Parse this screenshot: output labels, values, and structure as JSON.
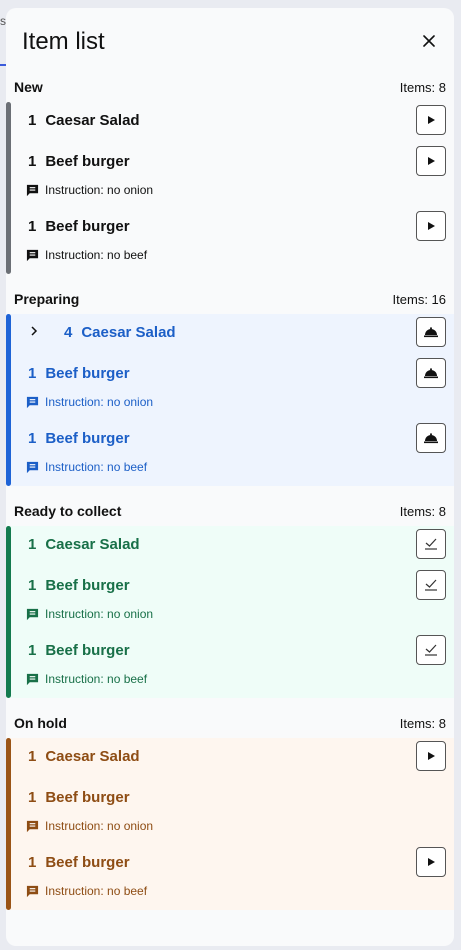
{
  "background_tab_fragment": "s",
  "panel": {
    "title": "Item list",
    "close_icon": "close-icon"
  },
  "sections": {
    "new": {
      "title": "New",
      "count": "Items: 8",
      "color": "#6b6f75",
      "items": [
        {
          "qty": "1",
          "name": "Caesar Salad",
          "instruction": null,
          "action": "play-icon"
        },
        {
          "qty": "1",
          "name": "Beef burger",
          "instruction": "Instruction: no onion",
          "action": "play-icon"
        },
        {
          "qty": "1",
          "name": "Beef burger",
          "instruction": "Instruction: no beef",
          "action": "play-icon"
        }
      ]
    },
    "preparing": {
      "title": "Preparing",
      "count": "Items: 16",
      "color": "#1e63d6",
      "items": [
        {
          "qty": "4",
          "name": "Caesar Salad",
          "instruction": null,
          "action": "cloche-icon",
          "expand_icon": "chevron-right-icon"
        },
        {
          "qty": "1",
          "name": "Beef burger",
          "instruction": "Instruction: no onion",
          "action": "cloche-icon"
        },
        {
          "qty": "1",
          "name": "Beef burger",
          "instruction": "Instruction: no beef",
          "action": "cloche-icon"
        }
      ]
    },
    "ready": {
      "title": "Ready to collect",
      "count": "Items: 8",
      "color": "#137a4e",
      "items": [
        {
          "qty": "1",
          "name": "Caesar Salad",
          "instruction": null,
          "action": "check-icon"
        },
        {
          "qty": "1",
          "name": "Beef burger",
          "instruction": "Instruction: no onion",
          "action": "check-icon"
        },
        {
          "qty": "1",
          "name": "Beef burger",
          "instruction": "Instruction: no beef",
          "action": "check-icon"
        }
      ]
    },
    "on_hold": {
      "title": "On hold",
      "count": "Items: 8",
      "color": "#9a5416",
      "items": [
        {
          "qty": "1",
          "name": "Caesar Salad",
          "instruction": null,
          "action": "play-icon"
        },
        {
          "qty": "1",
          "name": "Beef burger",
          "instruction": "Instruction: no onion",
          "action": null
        },
        {
          "qty": "1",
          "name": "Beef burger",
          "instruction": "Instruction: no beef",
          "action": "play-icon"
        }
      ]
    }
  }
}
